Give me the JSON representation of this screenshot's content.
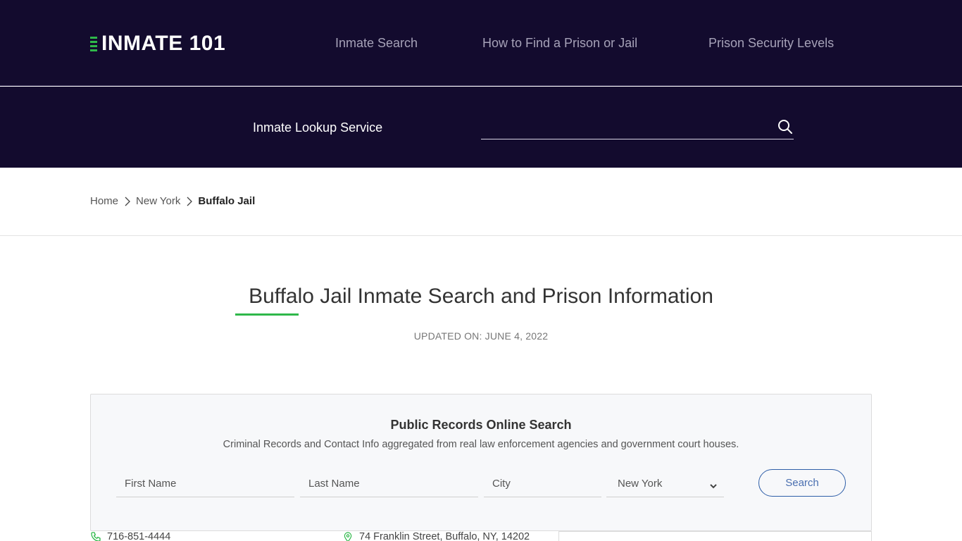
{
  "header": {
    "logo_text": "INMATE 101",
    "nav": [
      {
        "label": "Inmate Search"
      },
      {
        "label": "How to Find a Prison or Jail"
      },
      {
        "label": "Prison Security Levels"
      }
    ]
  },
  "lookup": {
    "label": "Inmate Lookup Service",
    "input_value": "",
    "search_icon": "search-icon"
  },
  "breadcrumb": {
    "items": [
      {
        "label": "Home"
      },
      {
        "label": "New York"
      }
    ],
    "current": "Buffalo Jail"
  },
  "page": {
    "title": "Buffalo Jail Inmate Search and Prison Information",
    "updated": "UPDATED ON: JUNE 4, 2022"
  },
  "search_card": {
    "title": "Public Records Online Search",
    "subtitle": "Criminal Records and Contact Info aggregated from real law enforcement agencies and government court houses.",
    "first_name_placeholder": "First Name",
    "last_name_placeholder": "Last Name",
    "city_placeholder": "City",
    "state_selected": "New York",
    "search_label": "Search"
  },
  "contact": {
    "phone": "716-851-4444",
    "address": "74 Franklin Street, Buffalo, NY, 14202"
  },
  "colors": {
    "header_bg": "#130b2e",
    "accent_green": "#2fb84a",
    "button_blue": "#2e5ea8"
  }
}
